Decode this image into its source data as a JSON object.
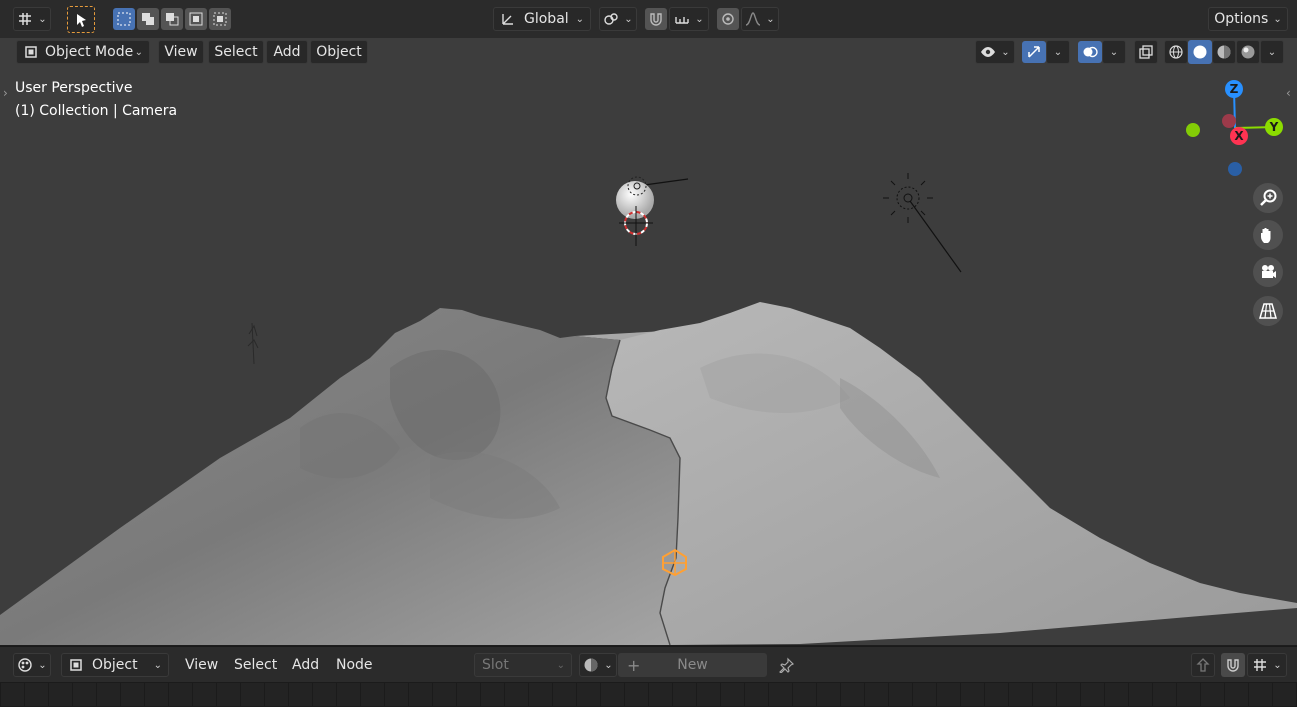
{
  "top_toolbar": {
    "transform_orientation": "Global",
    "options_label": "Options"
  },
  "viewport_header": {
    "mode_label": "Object Mode",
    "menus": [
      "View",
      "Select",
      "Add",
      "Object"
    ]
  },
  "viewport": {
    "view_name": "User Perspective",
    "collection_info": "(1) Collection | Camera",
    "gizmo_axes": {
      "z": "Z",
      "x": "X",
      "y": "Y"
    }
  },
  "bottom_header": {
    "editor_mode": "Object",
    "menus": [
      "View",
      "Select",
      "Add",
      "Node"
    ],
    "slot_placeholder": "Slot",
    "new_label": "New"
  },
  "colors": {
    "accent_blue": "#4772b3",
    "axis_x": "#ff3352",
    "axis_y": "#8bdc00",
    "axis_z": "#2890ff",
    "selected_orange": "#ffa033"
  }
}
